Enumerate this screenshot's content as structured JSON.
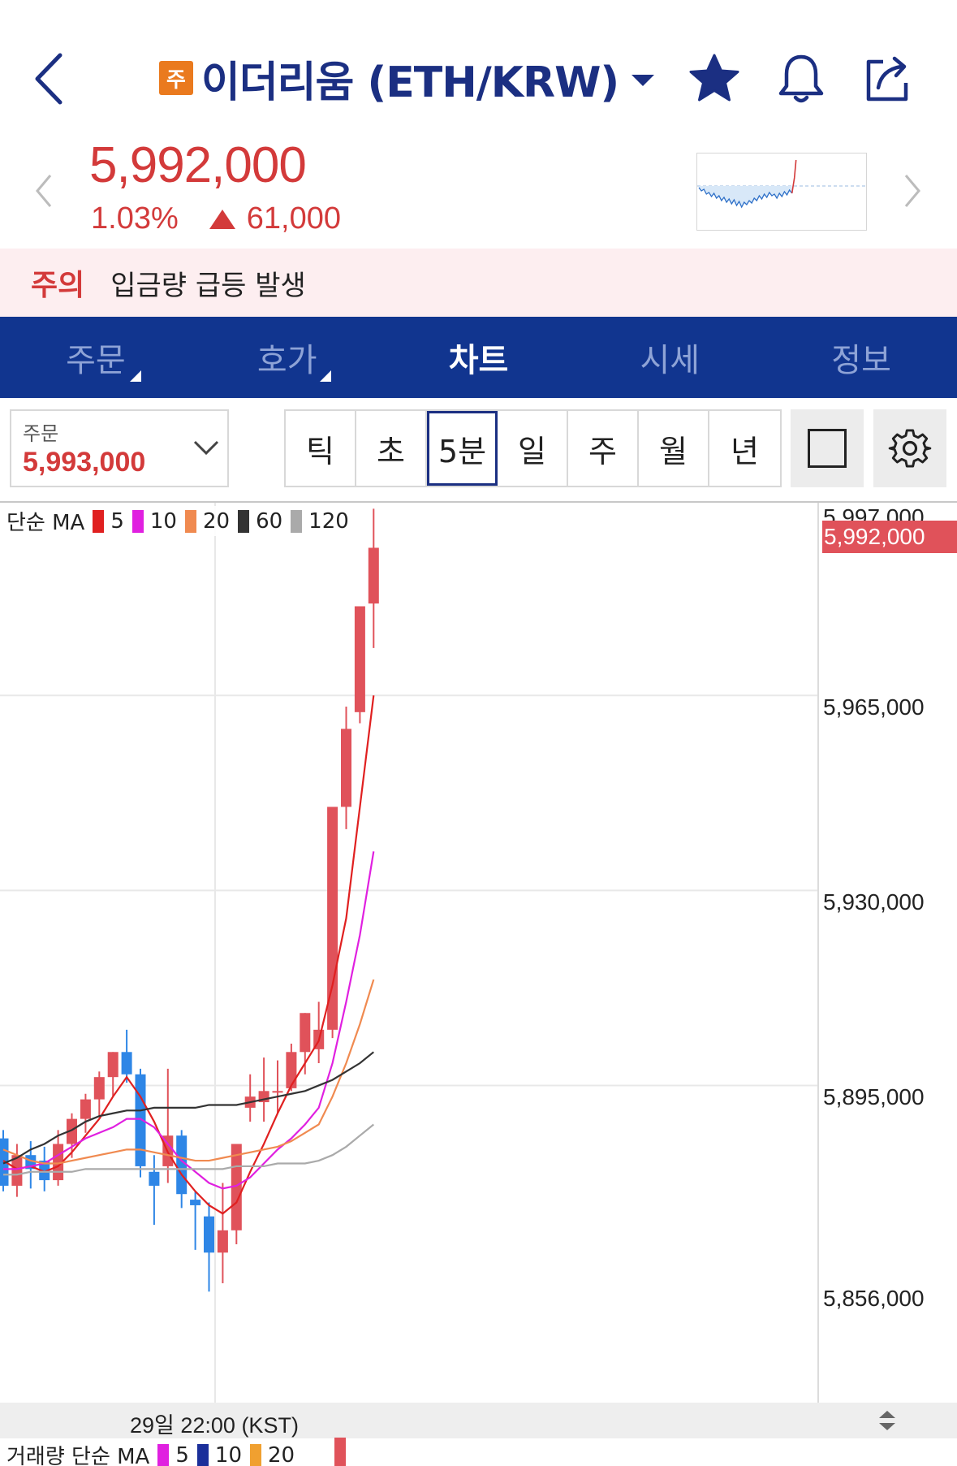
{
  "header": {
    "badge": "주",
    "title": "이더리움 (ETH/KRW)",
    "icons": [
      "back-icon",
      "chevron-down-icon",
      "star-icon",
      "bell-icon",
      "share-icon"
    ]
  },
  "quote": {
    "price": "5,992,000",
    "change_rate": "1.03%",
    "change_amount": "61,000",
    "up_color": "#d33a3a"
  },
  "alert": {
    "tag": "주의",
    "message": "입금량 급등 발생"
  },
  "tabs": [
    {
      "label": "주문"
    },
    {
      "label": "호가"
    },
    {
      "label": "차트"
    },
    {
      "label": "시세"
    },
    {
      "label": "정보"
    }
  ],
  "active_tab": "차트",
  "order": {
    "label": "주문",
    "value": "5,993,000"
  },
  "periods": [
    {
      "label": "틱"
    },
    {
      "label": "초"
    },
    {
      "label": "5분"
    },
    {
      "label": "일"
    },
    {
      "label": "주"
    },
    {
      "label": "월"
    },
    {
      "label": "년"
    }
  ],
  "active_period": "5분",
  "chart": {
    "ma_title": "단순 MA",
    "ma": [
      {
        "label": "5",
        "color": "#e02020"
      },
      {
        "label": "10",
        "color": "#e020e0"
      },
      {
        "label": "20",
        "color": "#f08a50"
      },
      {
        "label": "60",
        "color": "#333333"
      },
      {
        "label": "120",
        "color": "#aaaaaa"
      }
    ],
    "overlapped_tick": "5,997,000",
    "y_ticks": [
      "5,965,000",
      "5,930,000",
      "5,895,000",
      "5,856,000"
    ],
    "current_price": "5,992,000",
    "time_label": "29일 22:00 (KST)",
    "up_color": "#e0525a",
    "down_color": "#2e86e6"
  },
  "volume": {
    "title": "거래량 단순 MA",
    "ma": [
      {
        "label": "5",
        "color": "#e020e0"
      },
      {
        "label": "10",
        "color": "#1b2f9a"
      },
      {
        "label": "20",
        "color": "#f0a030"
      }
    ]
  },
  "chart_data": {
    "type": "candlestick",
    "interval": "5분",
    "y_range": [
      5856000,
      5999000
    ],
    "candles": [
      {
        "o": 5885500,
        "h": 5887000,
        "l": 5876000,
        "c": 5877000
      },
      {
        "o": 5877000,
        "h": 5884500,
        "l": 5875000,
        "c": 5882500
      },
      {
        "o": 5882500,
        "h": 5885000,
        "l": 5876500,
        "c": 5880000
      },
      {
        "o": 5881500,
        "h": 5884000,
        "l": 5876000,
        "c": 5878000
      },
      {
        "o": 5878000,
        "h": 5887000,
        "l": 5877000,
        "c": 5884500
      },
      {
        "o": 5884500,
        "h": 5890000,
        "l": 5882000,
        "c": 5889000
      },
      {
        "o": 5889000,
        "h": 5893500,
        "l": 5886500,
        "c": 5892500
      },
      {
        "o": 5892500,
        "h": 5897500,
        "l": 5889500,
        "c": 5896500
      },
      {
        "o": 5896500,
        "h": 5901000,
        "l": 5893000,
        "c": 5901000
      },
      {
        "o": 5901000,
        "h": 5905000,
        "l": 5895500,
        "c": 5897000
      },
      {
        "o": 5897000,
        "h": 5898000,
        "l": 5878500,
        "c": 5880500
      },
      {
        "o": 5879500,
        "h": 5882500,
        "l": 5870000,
        "c": 5877000
      },
      {
        "o": 5880500,
        "h": 5898000,
        "l": 5877500,
        "c": 5886000
      },
      {
        "o": 5886000,
        "h": 5887000,
        "l": 5873000,
        "c": 5875500
      },
      {
        "o": 5874500,
        "h": 5876000,
        "l": 5865500,
        "c": 5873500
      },
      {
        "o": 5871500,
        "h": 5874000,
        "l": 5858000,
        "c": 5865000
      },
      {
        "o": 5865000,
        "h": 5877500,
        "l": 5859500,
        "c": 5869000
      },
      {
        "o": 5869000,
        "h": 5883000,
        "l": 5866500,
        "c": 5884500
      },
      {
        "o": 5891000,
        "h": 5897000,
        "l": 5888500,
        "c": 5893000
      },
      {
        "o": 5892000,
        "h": 5900000,
        "l": 5888500,
        "c": 5894000
      },
      {
        "o": 5894000,
        "h": 5899500,
        "l": 5890000,
        "c": 5894000
      },
      {
        "o": 5894500,
        "h": 5902500,
        "l": 5894000,
        "c": 5901000
      },
      {
        "o": 5901000,
        "h": 5908000,
        "l": 5897000,
        "c": 5908000
      },
      {
        "o": 5901500,
        "h": 5910000,
        "l": 5899000,
        "c": 5905000
      },
      {
        "o": 5905000,
        "h": 5945000,
        "l": 5903500,
        "c": 5945000
      },
      {
        "o": 5945000,
        "h": 5963000,
        "l": 5941000,
        "c": 5959000
      },
      {
        "o": 5962000,
        "h": 5981000,
        "l": 5960000,
        "c": 5981000
      },
      {
        "o": 5981500,
        "h": 5998500,
        "l": 5973500,
        "c": 5991500
      }
    ],
    "ma_lines": [
      {
        "name": "5",
        "values": [
          5881500,
          5880000,
          5880500,
          5879500,
          5880500,
          5883000,
          5886000,
          5889000,
          5893000,
          5896500,
          5893000,
          5888500,
          5883000,
          5879000,
          5876000,
          5873500,
          5872000,
          5874000,
          5879500,
          5884500,
          5890000,
          5895000,
          5899000,
          5903000,
          5913000,
          5925000,
          5945000,
          5965000
        ]
      },
      {
        "name": "10",
        "values": [
          5880000,
          5880000,
          5880500,
          5881000,
          5882500,
          5884000,
          5885500,
          5886500,
          5887500,
          5889000,
          5889000,
          5887500,
          5884500,
          5881500,
          5879500,
          5877500,
          5876500,
          5877000,
          5878500,
          5881000,
          5883500,
          5885500,
          5888000,
          5891000,
          5899000,
          5910000,
          5922000,
          5937000
        ]
      },
      {
        "name": "20",
        "values": [
          5883500,
          5882500,
          5881500,
          5881000,
          5881000,
          5881500,
          5882000,
          5882500,
          5883000,
          5883500,
          5883500,
          5883000,
          5882500,
          5882000,
          5881500,
          5881500,
          5882000,
          5882500,
          5883000,
          5883500,
          5884000,
          5885000,
          5886500,
          5888000,
          5893000,
          5899000,
          5906000,
          5914000
        ]
      },
      {
        "name": "60",
        "values": [
          5881000,
          5882000,
          5883500,
          5884500,
          5886000,
          5887000,
          5888500,
          5889500,
          5890000,
          5890500,
          5890500,
          5891000,
          5891000,
          5891000,
          5891000,
          5891500,
          5891500,
          5891500,
          5892000,
          5892500,
          5893000,
          5893500,
          5894000,
          5895000,
          5896000,
          5897500,
          5899000,
          5901000
        ]
      },
      {
        "name": "120",
        "values": [
          5879000,
          5879000,
          5879500,
          5879500,
          5879500,
          5879500,
          5880000,
          5880000,
          5880000,
          5880000,
          5880000,
          5880000,
          5880000,
          5880000,
          5880000,
          5880000,
          5880000,
          5880500,
          5880500,
          5880500,
          5881000,
          5881000,
          5881000,
          5881500,
          5882500,
          5884000,
          5886000,
          5888000
        ]
      }
    ]
  }
}
